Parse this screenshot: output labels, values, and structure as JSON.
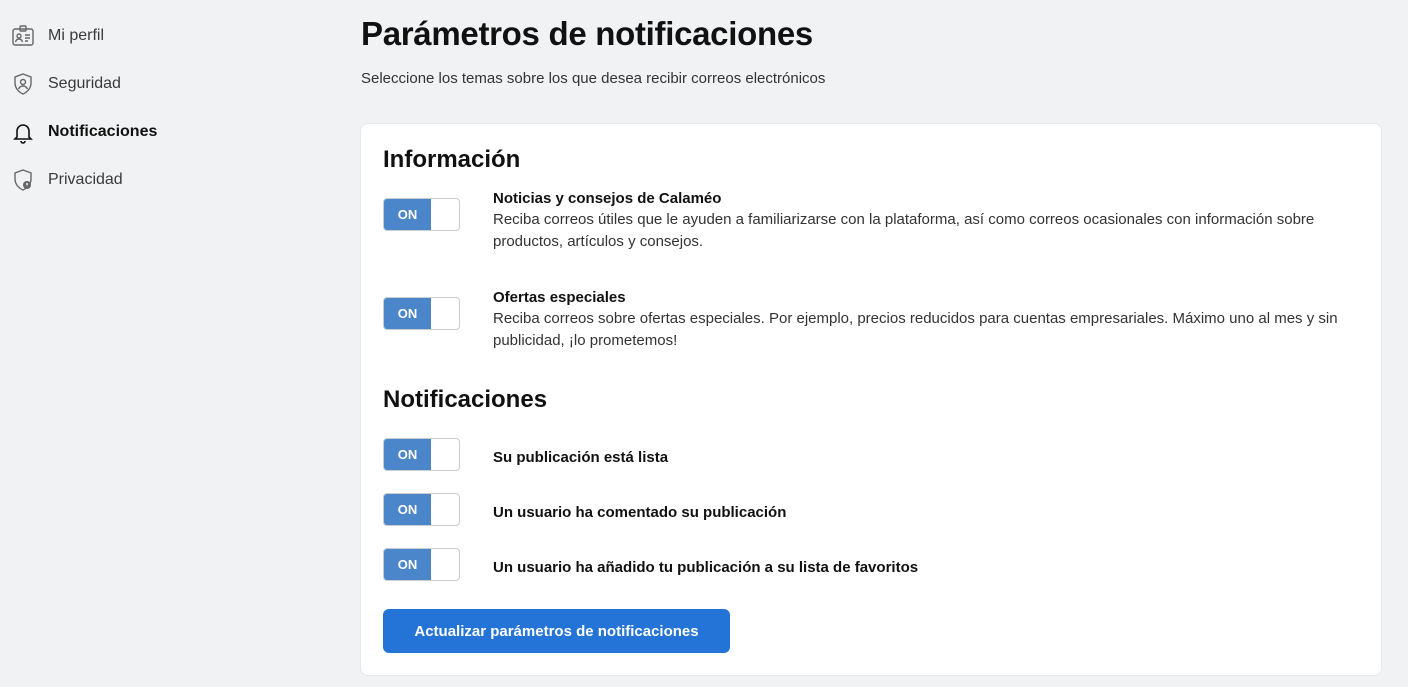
{
  "sidebar": {
    "items": [
      {
        "label": "Mi perfil",
        "icon": "id-card-icon"
      },
      {
        "label": "Seguridad",
        "icon": "shield-icon"
      },
      {
        "label": "Notificaciones",
        "icon": "bell-icon",
        "active": true
      },
      {
        "label": "Privacidad",
        "icon": "privacy-shield-icon"
      }
    ]
  },
  "header": {
    "title": "Parámetros de notificaciones",
    "subtitle": "Seleccione los temas sobre los que desea recibir correos electrónicos"
  },
  "info": {
    "title": "Información",
    "options": [
      {
        "state": "ON",
        "title": "Noticias y consejos de Calaméo",
        "description": "Reciba correos útiles que le ayuden a familiarizarse con la plataforma, así como correos ocasionales con información sobre productos, artículos y consejos."
      },
      {
        "state": "ON",
        "title": "Ofertas especiales",
        "description": "Reciba correos sobre ofertas especiales. Por ejemplo, precios reducidos para cuentas empresariales. Máximo uno al mes y sin publicidad, ¡lo prometemos!"
      }
    ]
  },
  "notifications": {
    "title": "Notificaciones",
    "options": [
      {
        "state": "ON",
        "title": "Su publicación está lista"
      },
      {
        "state": "ON",
        "title": "Un usuario ha comentado su publicación"
      },
      {
        "state": "ON",
        "title": "Un usuario ha añadido tu publicación a su lista de favoritos"
      }
    ]
  },
  "actions": {
    "update_label": "Actualizar parámetros de notificaciones"
  },
  "colors": {
    "accent": "#2374d6",
    "toggle_on": "#4a86c9",
    "background": "#f1f2f4"
  }
}
